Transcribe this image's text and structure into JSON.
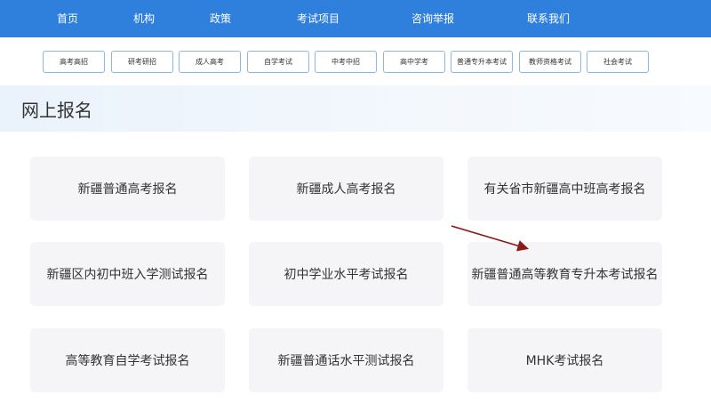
{
  "topnav": {
    "items": [
      "首页",
      "机构",
      "政策",
      "考试项目",
      "咨询举报",
      "联系我们"
    ]
  },
  "subnav": {
    "items": [
      "高考高招",
      "研考研招",
      "成人高考",
      "自学考试",
      "中考中招",
      "高中学考",
      "普通专升本考试",
      "教师资格考试",
      "社会考试"
    ]
  },
  "banner": {
    "title": "网上报名"
  },
  "cards": [
    "新疆普通高考报名",
    "新疆成人高考报名",
    "有关省市新疆高中班高考报名",
    "新疆区内初中班入学测试报名",
    "初中学业水平考试报名",
    "新疆普通高等教育专升本考试报名",
    "高等教育自学考试报名",
    "新疆普通话水平测试报名",
    "MHK考试报名"
  ],
  "colors": {
    "nav_bg": "#2f7fdc",
    "button_border": "#8fb6e2",
    "card_bg": "#f5f5f7",
    "annotation_arrow": "#8b1a1a"
  }
}
